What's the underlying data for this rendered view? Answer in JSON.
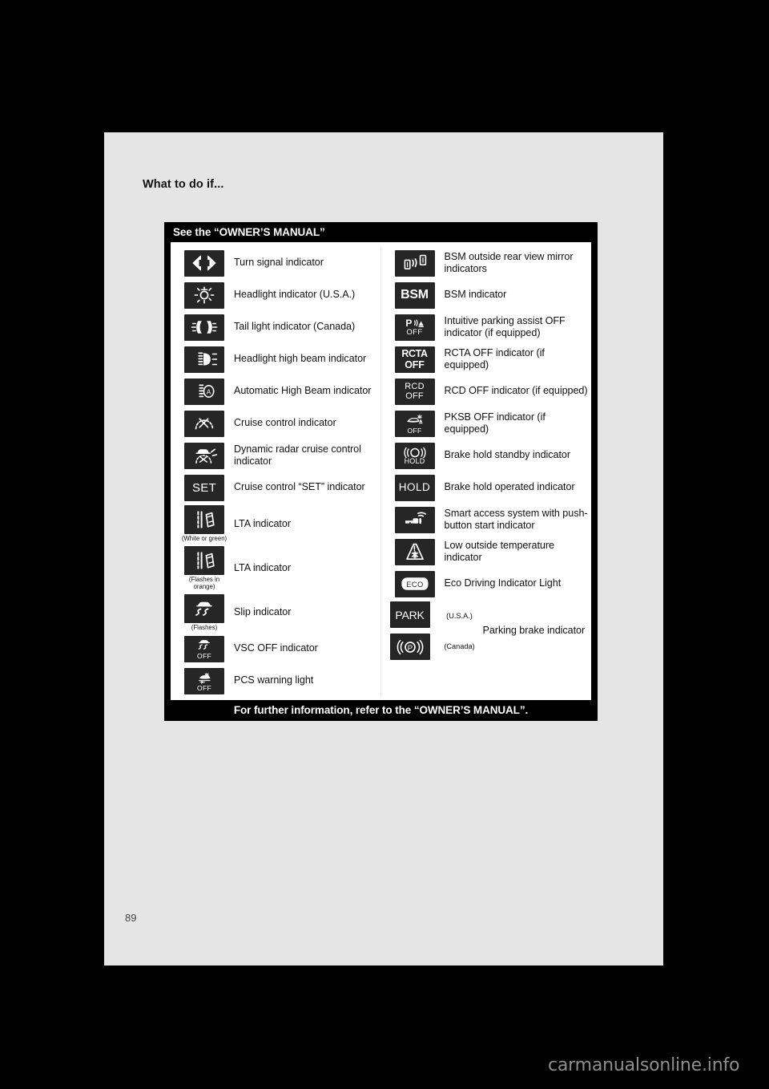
{
  "page": {
    "running_head": "What to do if...",
    "page_number": "89",
    "watermark": "carmanualsonline.info"
  },
  "panel": {
    "header": "See the “OWNER’S MANUAL”",
    "footer": "For further information, refer to the “OWNER’S MANUAL”.",
    "left_column": [
      {
        "icon": "turn-signal-icon",
        "label": "Turn signal indicator",
        "note": ""
      },
      {
        "icon": "headlight-icon",
        "label": "Headlight indicator (U.S.A.)",
        "note": ""
      },
      {
        "icon": "tail-light-icon",
        "label": "Tail light indicator (Canada)",
        "note": ""
      },
      {
        "icon": "high-beam-icon",
        "label": "Headlight high beam indicator",
        "note": ""
      },
      {
        "icon": "automatic-high-beam-icon",
        "label": "Automatic High Beam indicator",
        "note": ""
      },
      {
        "icon": "cruise-control-icon",
        "label": "Cruise control indicator",
        "note": ""
      },
      {
        "icon": "dynamic-radar-cruise-icon",
        "label": "Dynamic radar cruise control indicator",
        "note": ""
      },
      {
        "icon": "cruise-set-icon",
        "label": "Cruise control “SET” indicator",
        "note": "",
        "text": "SET"
      },
      {
        "icon": "lta-icon",
        "label": "LTA indicator",
        "note": "(White or green)"
      },
      {
        "icon": "lta-flashing-icon",
        "label": "LTA indicator",
        "note": "(Flashes in orange)"
      },
      {
        "icon": "slip-icon",
        "label": "Slip indicator",
        "note": "(Flashes)"
      },
      {
        "icon": "vsc-off-icon",
        "label": "VSC OFF indicator",
        "note": "",
        "text": "OFF"
      },
      {
        "icon": "pcs-warning-icon",
        "label": "PCS warning light",
        "note": "",
        "text": "OFF"
      }
    ],
    "right_column": [
      {
        "icon": "bsm-mirror-icon",
        "label": "BSM outside rear view mirror indicators",
        "note": ""
      },
      {
        "icon": "bsm-icon",
        "label": "BSM indicator",
        "note": "",
        "text": "BSM"
      },
      {
        "icon": "parking-assist-off-icon",
        "label": "Intuitive parking assist OFF indicator (if equipped)",
        "note": "",
        "text": "OFF"
      },
      {
        "icon": "rcta-off-icon",
        "label": "RCTA OFF indicator (if equipped)",
        "note": "",
        "text": "RCTA OFF"
      },
      {
        "icon": "rcd-off-icon",
        "label": "RCD OFF indicator (if equipped)",
        "note": "",
        "text": "RCD OFF"
      },
      {
        "icon": "pksb-off-icon",
        "label": "PKSB OFF indicator (if equipped)",
        "note": "",
        "text": "OFF"
      },
      {
        "icon": "brake-hold-standby-icon",
        "label": "Brake hold standby indicator",
        "note": "",
        "text": "HOLD"
      },
      {
        "icon": "brake-hold-operated-icon",
        "label": "Brake hold operated indicator",
        "note": "",
        "text": "HOLD"
      },
      {
        "icon": "smart-access-key-icon",
        "label": "Smart access system with push-button start indicator",
        "note": ""
      },
      {
        "icon": "low-temperature-icon",
        "label": "Low outside temperature indicator",
        "note": ""
      },
      {
        "icon": "eco-driving-icon",
        "label": "Eco Driving Indicator Light",
        "note": "",
        "text": "ECO"
      }
    ],
    "parking_brake": {
      "label": "Parking brake indicator",
      "usa_note": "(U.S.A.)",
      "canada_note": "(Canada)",
      "usa_icon": "park-text-icon",
      "usa_text": "PARK",
      "canada_icon": "parking-brake-p-icon"
    }
  },
  "colors": {
    "page_background": "#e5e5e5",
    "panel_frame": "#000000",
    "panel_body": "#ffffff",
    "icon_background": "#262626",
    "icon_foreground": "#ffffff",
    "canvas": "#000000"
  }
}
